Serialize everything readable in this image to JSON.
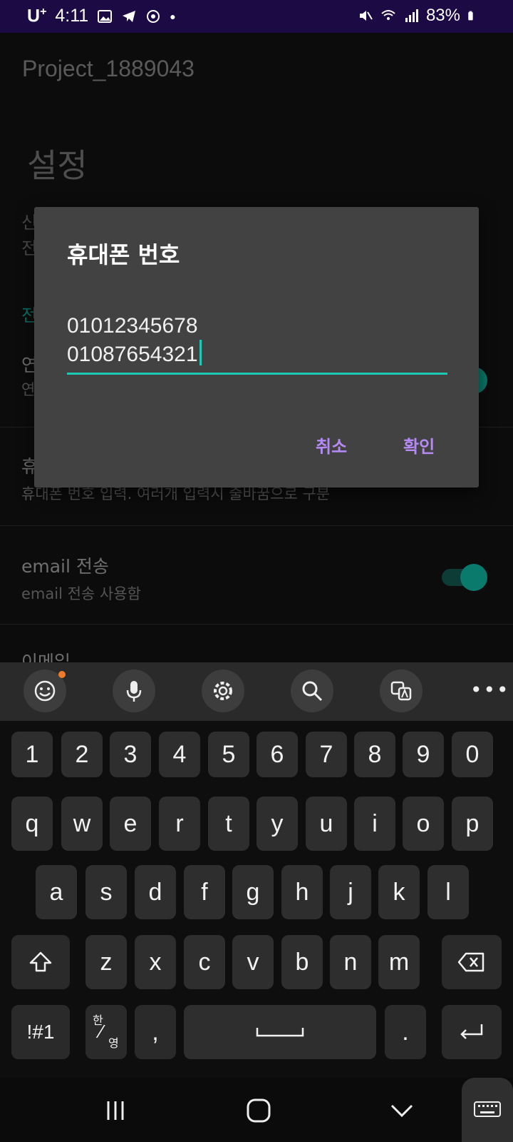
{
  "status_bar": {
    "carrier": "U",
    "carrier_sup": "+",
    "time": "4:11",
    "battery": "83%"
  },
  "app": {
    "title": "Project_1889043",
    "settings_title": "설정",
    "partial_1": "신",
    "partial_2": "전",
    "section_partial": "전",
    "row_partial_title": "연",
    "row_partial_sub": "연",
    "phone_row_partial": "휴",
    "phone_row_sub": "휴대폰 번호 입력. 여러개 입력시 줄바꿈으로 구분",
    "email_row": {
      "title": "email 전송",
      "subtitle": "email 전송 사용함",
      "enabled": true
    },
    "next_row_partial": "이메일"
  },
  "dialog": {
    "title": "휴대폰 번호",
    "value_lines": [
      "01012345678",
      "01087654321"
    ],
    "cancel": "취소",
    "ok": "확인",
    "accent": "#1bc9b5",
    "button_color": "#b58af5"
  },
  "keyboard": {
    "toolbar": [
      "emoji-icon",
      "mic-icon",
      "gear-icon",
      "search-icon",
      "translate-icon",
      "more-icon"
    ],
    "numbers": [
      "1",
      "2",
      "3",
      "4",
      "5",
      "6",
      "7",
      "8",
      "9",
      "0"
    ],
    "row1": [
      "q",
      "w",
      "e",
      "r",
      "t",
      "y",
      "u",
      "i",
      "o",
      "p"
    ],
    "row2": [
      "a",
      "s",
      "d",
      "f",
      "g",
      "h",
      "j",
      "k",
      "l"
    ],
    "row3": [
      "z",
      "x",
      "c",
      "v",
      "b",
      "n",
      "m"
    ],
    "sym_label": "!#1",
    "lang_top": "한",
    "lang_bottom": "영",
    "comma": ",",
    "period": "."
  }
}
